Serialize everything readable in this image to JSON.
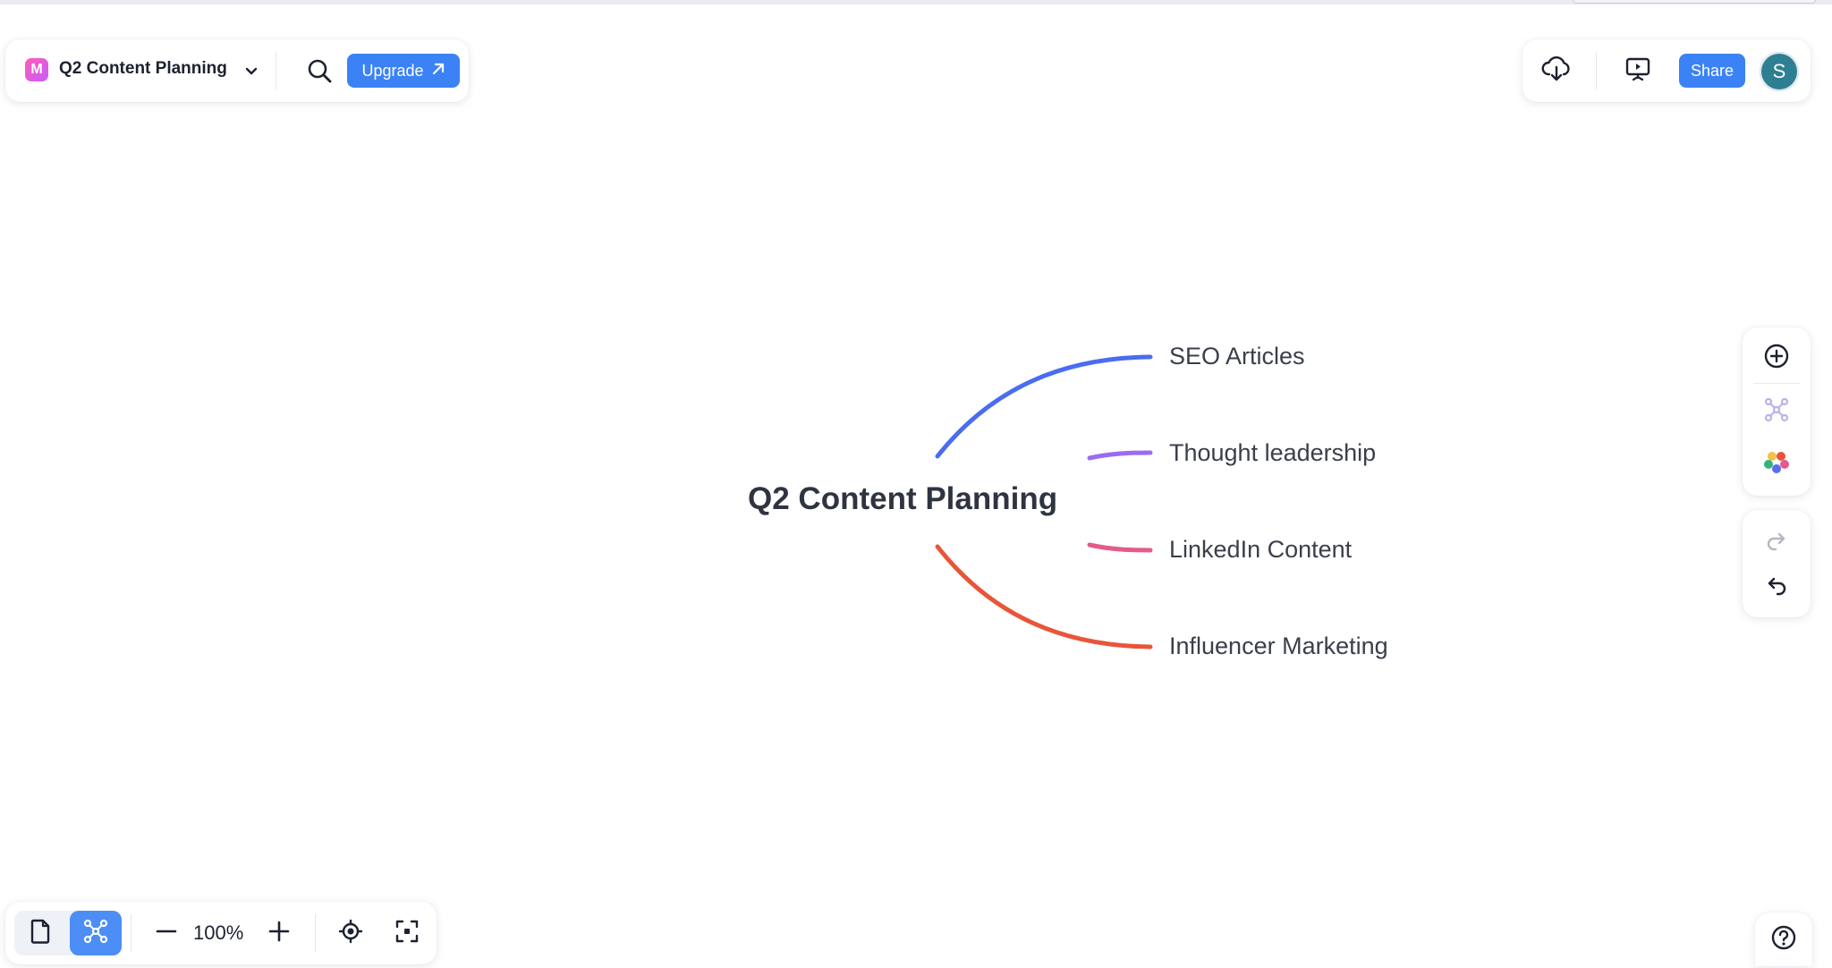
{
  "app": {
    "doc_title": "Q2 Content Planning",
    "logo_letter": "M",
    "upgrade_label": "Upgrade",
    "share_label": "Share",
    "avatar_initial": "S"
  },
  "mindmap": {
    "root": "Q2 Content Planning",
    "branches": [
      {
        "label": "SEO Articles",
        "color": "#4a6cf0"
      },
      {
        "label": "Thought leadership",
        "color": "#9b6cf0"
      },
      {
        "label": "LinkedIn Content",
        "color": "#e45a8c"
      },
      {
        "label": "Influencer Marketing",
        "color": "#e8553a"
      }
    ]
  },
  "bottom_toolbar": {
    "zoom_level": "100%"
  },
  "icons": {
    "search": "search-icon",
    "upgrade_arrow": "arrow-up-right-icon",
    "download": "cloud-download-icon",
    "present": "presentation-icon",
    "add_node": "plus-circle-icon",
    "layout": "mindmap-layout-icon",
    "theme": "color-palette-icon",
    "redo": "redo-icon",
    "undo": "undo-icon",
    "outline_view": "document-icon",
    "mindmap_view": "mindmap-icon",
    "zoom_out": "minus-icon",
    "zoom_in": "plus-icon",
    "locate": "locate-icon",
    "fit": "fit-screen-icon",
    "help": "help-icon"
  }
}
